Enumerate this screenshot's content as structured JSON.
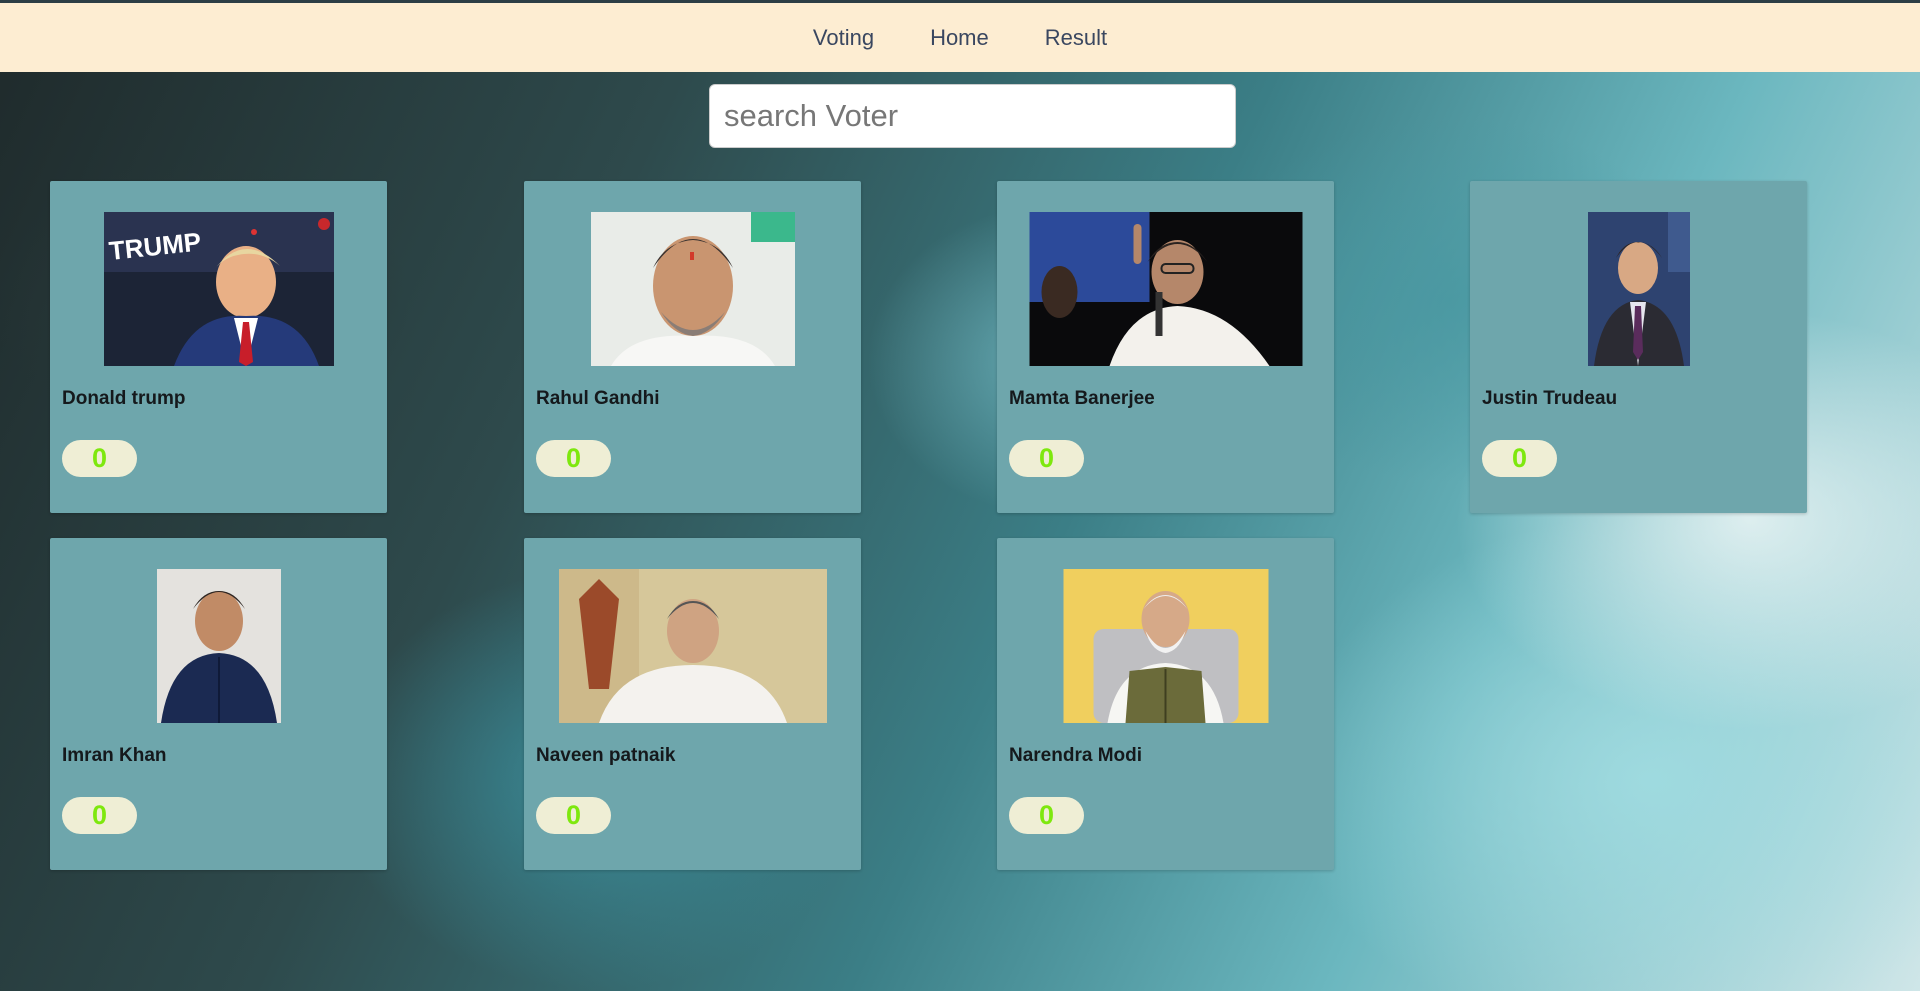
{
  "nav": {
    "items": [
      {
        "label": "Voting"
      },
      {
        "label": "Home"
      },
      {
        "label": "Result"
      }
    ]
  },
  "search": {
    "placeholder": "search Voter",
    "value": ""
  },
  "candidates": [
    {
      "name": "Donald trump",
      "votes": "0",
      "photo_text": "TRUMP"
    },
    {
      "name": "Rahul Gandhi",
      "votes": "0"
    },
    {
      "name": "Mamta Banerjee",
      "votes": "0"
    },
    {
      "name": "Justin Trudeau",
      "votes": "0"
    },
    {
      "name": "Imran Khan",
      "votes": "0"
    },
    {
      "name": "Naveen patnaik",
      "votes": "0"
    },
    {
      "name": "Narendra Modi",
      "votes": "0"
    }
  ],
  "colors": {
    "card_bg": "#6ea6ac",
    "navbar_bg": "#fdedd2",
    "vote_text": "#7ee80e",
    "vote_bg": "#efeed5"
  }
}
